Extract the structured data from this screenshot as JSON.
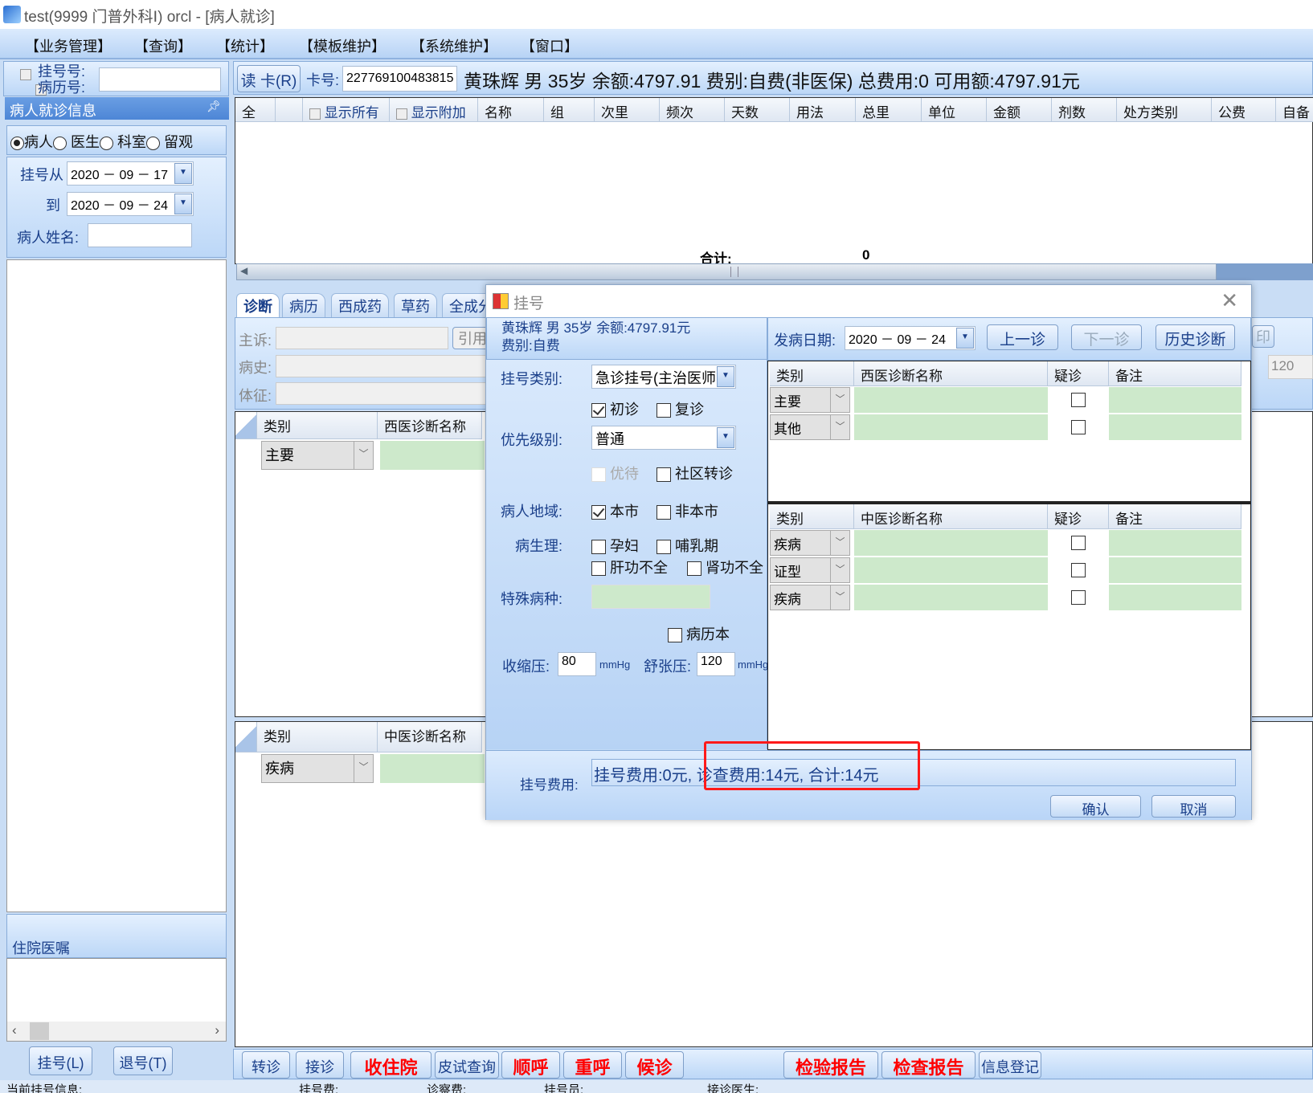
{
  "window": {
    "title": "test(9999 门普外科Ⅰ) orcl - [病人就诊]"
  },
  "menu": [
    "【业务管理】",
    "【查询】",
    "【统计】",
    "【模板维护】",
    "【系统维护】",
    "【窗口】"
  ],
  "left": {
    "reg_no_label": "挂号号:",
    "record_no_label": "病历号:",
    "section_title": "病人就诊信息",
    "pin_icon": "pin-icon",
    "radios": [
      "病人",
      "医生",
      "科室",
      "留观"
    ],
    "from_label": "挂号从",
    "from_date": "2020 － 09 － 17",
    "to_label": "到",
    "to_date": "2020 － 09 － 24",
    "name_label": "病人姓名:",
    "inpatient_title": "住院医嘱",
    "register_button": "挂号(L)",
    "unregister_button": "退号(T)"
  },
  "patient_bar": {
    "read_card": "读 卡(R)",
    "card_label": "卡号:",
    "card_no": "227769100483815",
    "info": "黄珠辉 男 35岁 余额:4797.91 费别:自费(非医保) 总费用:0 可用额:4797.91元"
  },
  "rx_table": {
    "all": "全",
    "show_all": "显示所有",
    "show_extra": "显示附加",
    "columns": [
      "名称",
      "组",
      "次里",
      "频次",
      "天数",
      "用法",
      "总里",
      "单位",
      "金额",
      "剂数",
      "处方类别",
      "公费",
      "自备"
    ],
    "total_label": "合计:",
    "total_value": "0"
  },
  "tabs": [
    "诊断",
    "病历",
    "西成药",
    "草药",
    "全成分"
  ],
  "diag_form": {
    "complaint": "主诉:",
    "history": "病史:",
    "signs": "体征:",
    "cite": "引用"
  },
  "bg_western": {
    "col_type": "类别",
    "col_name": "西医诊断名称",
    "row_type": "主要"
  },
  "bg_chinese": {
    "col_type": "类别",
    "col_name": "中医诊断名称",
    "row_type": "疾病"
  },
  "bg_right": {
    "print": "印",
    "value": "120"
  },
  "bottom_buttons": [
    {
      "label": "转诊",
      "red": false
    },
    {
      "label": "接诊",
      "red": false
    },
    {
      "label": "收住院",
      "red": true
    },
    {
      "label": "皮试查询",
      "red": false
    },
    {
      "label": "顺呼",
      "red": true
    },
    {
      "label": "重呼",
      "red": true
    },
    {
      "label": "候诊",
      "red": true
    },
    {
      "label": "检验报告",
      "red": true
    },
    {
      "label": "检查报告",
      "red": true
    },
    {
      "label": "信息登记",
      "red": false
    }
  ],
  "status_bar": [
    "当前挂号信息:",
    "挂号费:",
    "诊察费:",
    "挂号员:",
    "接诊医生:"
  ],
  "dialog": {
    "title": "挂号",
    "patient_line1": "黄珠辉 男 35岁 余额:4797.91元",
    "patient_line2": "费别:自费",
    "reg_type_label": "挂号类别:",
    "reg_type_value": "急诊挂号(主治医师",
    "first_visit": "初诊",
    "first_visit_checked": true,
    "revisit": "复诊",
    "revisit_checked": false,
    "priority_label": "优先级别:",
    "priority_value": "普通",
    "preferential": "优待",
    "community_referral": "社区转诊",
    "region_label": "病人地域:",
    "local": "本市",
    "local_checked": true,
    "nonlocal": "非本市",
    "physio_label": "病生理:",
    "pregnant": "孕妇",
    "lactation": "哺乳期",
    "liver": "肝功不全",
    "kidney": "肾功不全",
    "special_label": "特殊病种:",
    "special_value": "",
    "record_book": "病历本",
    "systolic_label": "收缩压:",
    "systolic": "80",
    "unit": "mmHg",
    "diastolic_label": "舒张压:",
    "diastolic": "120",
    "onset_label": "发病日期:",
    "onset_date": "2020 － 09 － 24",
    "prev_button": "上一诊",
    "next_button": "下一诊",
    "history_button": "历史诊断",
    "western": {
      "columns": [
        "类别",
        "西医诊断名称",
        "疑诊",
        "备注"
      ],
      "rows": [
        "主要",
        "其他"
      ]
    },
    "chinese": {
      "columns": [
        "类别",
        "中医诊断名称",
        "疑诊",
        "备注"
      ],
      "rows": [
        "疾病",
        "证型",
        "疾病"
      ]
    },
    "fee_label": "挂号费用:",
    "fee_value": "挂号费用:0元, 诊查费用:14元, 合计:14元",
    "confirm": "确认",
    "cancel": "取消",
    "highlight_color": "#ff0000"
  }
}
